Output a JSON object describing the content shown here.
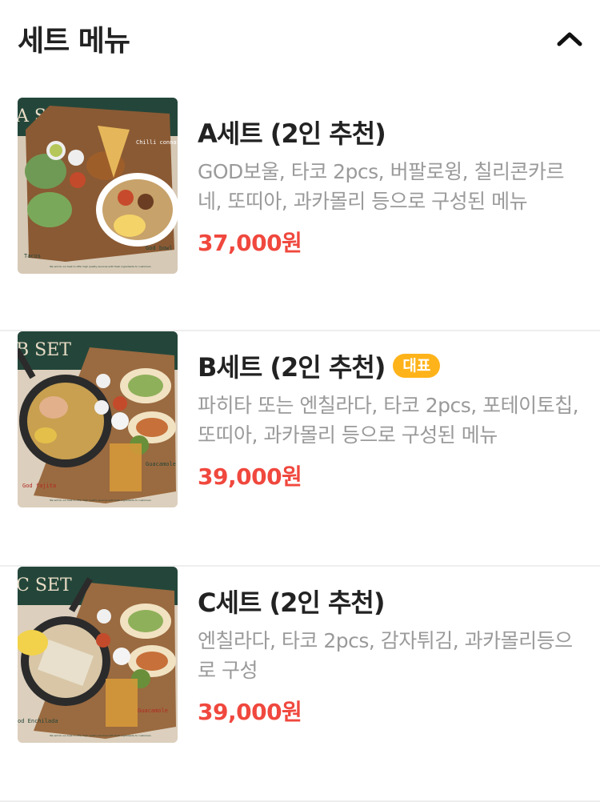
{
  "header": {
    "title": "세트 메뉴"
  },
  "colors": {
    "price": "#f0483e",
    "badge": "#ffb31a",
    "desc": "#9a9a9a"
  },
  "items": [
    {
      "name": "A세트 (2인 추천)",
      "description": "GOD보울, 타코 2pcs, 버팔로윙, 칠리콘카르네, 또띠아, 과카몰리 등으로 구성된 메뉴",
      "price": "37,000원",
      "image_texts": {
        "set": "A SET",
        "label1": "Chilli connarne",
        "label2": "Tacos",
        "label3": "God bowl",
        "footer": "We will do our best to offer high quality services with fresh ingredients to customers"
      }
    },
    {
      "name": "B세트 (2인 추천)",
      "badge": "대표",
      "description": "파히타 또는 엔칠라다, 타코 2pcs, 포테이토칩, 또띠아, 과카몰리 등으로 구성된 메뉴",
      "price": "39,000원",
      "image_texts": {
        "set": "B SET",
        "label1": "Guacamole",
        "label2": "God fajita",
        "footer": "We will do our best to offer high quality services with fresh ingredients to customers"
      }
    },
    {
      "name": "C세트 (2인 추천)",
      "description": "엔칠라다, 타코 2pcs, 감자튀김, 과카몰리등으로 구성",
      "price": "39,000원",
      "image_texts": {
        "set": "C SET",
        "label1": "Guacamole",
        "label2": "od Enchilada",
        "footer": "We will do our best to offer high quality services with fresh ingredients to customers"
      }
    }
  ]
}
